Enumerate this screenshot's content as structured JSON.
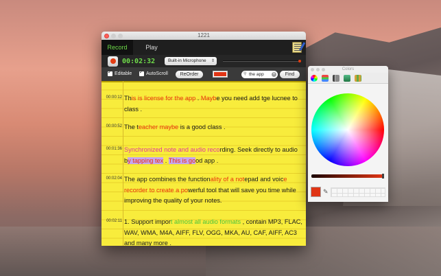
{
  "window": {
    "title": "1221",
    "tabs": [
      {
        "label": "Record",
        "active": true
      },
      {
        "label": "Play",
        "active": false
      }
    ]
  },
  "recorder": {
    "timer": "00:02:32",
    "device": "Built-in Microphone"
  },
  "controls": {
    "editable_label": "Editable",
    "editable_checked": true,
    "autoscroll_label": "AutoScroll",
    "autoscroll_checked": true,
    "reorder_label": "ReOrder",
    "search_value": "the app",
    "find_label": "Find",
    "text_color": "#e03515"
  },
  "notes": [
    {
      "time": "00:00:12",
      "parts": [
        {
          "t": "Th",
          "c": ""
        },
        {
          "t": "is is license for the app",
          "c": "r"
        },
        {
          "t": " . ",
          "c": ""
        },
        {
          "t": " Mayb",
          "c": "r"
        },
        {
          "t": "e you need add tge lucnee to class .",
          "c": ""
        }
      ]
    },
    {
      "time": "00:00:52",
      "parts": [
        {
          "t": "The t",
          "c": ""
        },
        {
          "t": "eacher maybe",
          "c": "r"
        },
        {
          "t": " is a good class .",
          "c": ""
        }
      ]
    },
    {
      "time": "00:01:36",
      "parts": [
        {
          "t": "Synchronized note and audio reco",
          "c": "m"
        },
        {
          "t": "rding. Seek directly to audio b",
          "c": ""
        },
        {
          "t": "y tapping tex",
          "c": "hl"
        },
        {
          "t": " . ",
          "c": ""
        },
        {
          "t": "This is go",
          "c": "hl"
        },
        {
          "t": "od app .",
          "c": ""
        }
      ]
    },
    {
      "time": "00:02:04",
      "parts": [
        {
          "t": "The app combines the function",
          "c": ""
        },
        {
          "t": "ality of a not",
          "c": "r"
        },
        {
          "t": "epad and voic",
          "c": ""
        },
        {
          "t": "e recorder to create a po",
          "c": "r"
        },
        {
          "t": "werful tool that will save you time while improving the quality of your notes.",
          "c": ""
        }
      ]
    },
    {
      "time": "00:02:11",
      "parts": [
        {
          "t": "1. Support impor",
          "c": ""
        },
        {
          "t": "t almost all audio formats",
          "c": "g"
        },
        {
          "t": " ,  contain MP3, FLAC, WAV, WMA, M4A, AIFF, FLV, OGG, MKA, AU, CAF, AIFF, AC3 and many more .",
          "c": ""
        }
      ]
    }
  ],
  "colors_panel": {
    "title": "Colors",
    "current_color": "#e03515"
  }
}
